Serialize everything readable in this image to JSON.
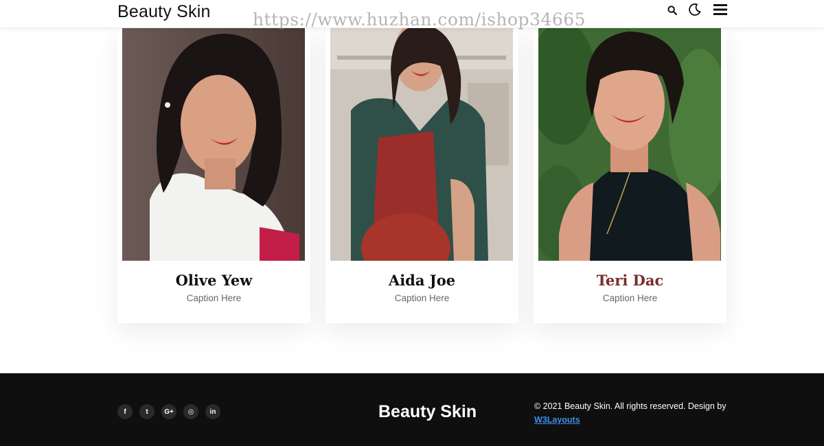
{
  "header": {
    "brand": "Beauty Skin",
    "watermark": "https://www.huzhan.com/ishop34665",
    "icons": [
      "search-icon",
      "moon-icon",
      "menu-icon"
    ]
  },
  "team": [
    {
      "name": "Olive Yew",
      "caption": "Caption Here"
    },
    {
      "name": "Aida Joe",
      "caption": "Caption Here"
    },
    {
      "name": "Teri Dac",
      "caption": "Caption Here"
    }
  ],
  "footer": {
    "social": [
      {
        "icon": "facebook-icon",
        "glyph": "f"
      },
      {
        "icon": "twitter-icon",
        "glyph": "t"
      },
      {
        "icon": "google-plus-icon",
        "glyph": "G+"
      },
      {
        "icon": "instagram-icon",
        "glyph": "◎"
      },
      {
        "icon": "linkedin-icon",
        "glyph": "in"
      }
    ],
    "brand": "Beauty Skin",
    "copyright": "© 2021 Beauty Skin. All rights reserved. Design by",
    "credit_link": "W3Layouts"
  },
  "colors": {
    "footer_bg": "#0f0f0f",
    "link": "#3d8fe6",
    "accent_name": "#7a2b2b"
  }
}
